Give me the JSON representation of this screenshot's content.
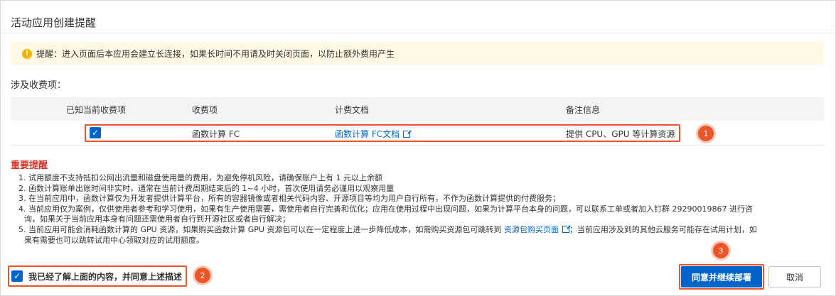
{
  "dialog": {
    "title": "活动应用创建提醒"
  },
  "notice": {
    "icon": "warning-icon",
    "text": "提醒：进入页面后本应用会建立长连接，如果长时间不用请及时关闭页面，以防止额外费用产生"
  },
  "billing": {
    "section_label": "涉及收费项：",
    "columns": [
      "已知当前收费项",
      "收费项",
      "计费文档",
      "备注信息"
    ],
    "rows": [
      {
        "checked": true,
        "item": "函数计算 FC",
        "doc": "函数计算 FC文档",
        "note": "提供 CPU、GPU 等计算资源"
      }
    ]
  },
  "important": {
    "title": "重要提醒",
    "notes": [
      "1. 试用额度不支持抵扣公网出流量和磁盘使用量的费用，为避免停机风险，请确保账户上有 1 元以上余额",
      "2. 函数计算账单出账时间非实时，通常在当前计费周期结束后的 1~4 小时，首次使用请务必谨用以观察用量",
      "3. 在当前应用中，函数计算仅为开发者提供计算平台，所有的容器镜像或者相关代码内容、开源项目等均为用户自行所有，不作为函数计算提供的付费服务；",
      "4. 当前应用仅为案例，仅供使用者参考和学习使用，如果有生产使用需要，需使用者自行完善和优化；应用在使用过程中出现问题，如果为计算平台本身的问题，可以联系工单或者加入钉群 29290019867 进行咨",
      "询，如果关于当前应用本身有问题还需使用者自行到开源社区或者自行解决；",
      "5. 当前应用可能会消耗函数计算的 GPU 资源，如果购买函数计算 GPU 资源包可以在一定程度上进一步降低成本，如需购买资源包可跳转到",
      "资源包购买页面",
      "；当前应用涉及到的其他云服务可能存在试用计划，如",
      "果有需要也可以跳转试用中心领取对应的试用额度。"
    ]
  },
  "footer": {
    "agree_label": "我已经了解上面的内容，并同意上述描述",
    "agree_checked": true,
    "confirm_label": "同意并继续部署",
    "cancel_label": "取消"
  },
  "annotations": [
    "1",
    "2",
    "3"
  ],
  "colors": {
    "primary": "#0064c8",
    "highlight": "#e8562a",
    "important": "#d93026",
    "notice_bg": "#fff9e6",
    "warning": "#f5b400"
  }
}
